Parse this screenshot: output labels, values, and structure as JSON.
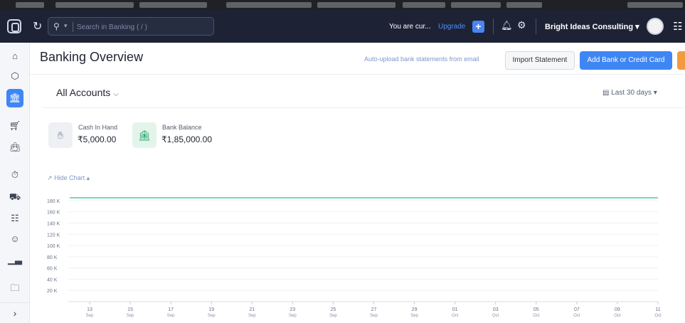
{
  "topbar": {
    "search_placeholder": "Search in Banking ( / )",
    "currency_text": "You are cur...",
    "upgrade_label": "Upgrade",
    "org_name": "Bright Ideas Consulting ▾"
  },
  "page": {
    "title": "Banking Overview",
    "auto_upload_link": "Auto-upload bank statements from email",
    "import_button": "Import Statement",
    "add_button": "Add Bank or Credit Card"
  },
  "accounts": {
    "selector": "All Accounts",
    "date_range": "Last 30 days ▾"
  },
  "stats": {
    "cash": {
      "label": "Cash In Hand",
      "value": "₹5,000.00"
    },
    "bank": {
      "label": "Bank Balance",
      "value": "₹1,85,000.00"
    }
  },
  "hide_chart_label": "Hide Chart ▴",
  "icons": {
    "sidebar": [
      "home-icon",
      "box-icon",
      "bank-icon",
      "cart-icon",
      "bag-icon",
      "clock-icon",
      "truck-icon",
      "document-icon",
      "users-icon",
      "reports-icon",
      "folder-icon"
    ]
  },
  "colors": {
    "topbar": "#1d2335",
    "accent": "#3f86f5",
    "series": "#52c7a8"
  },
  "chart_data": {
    "type": "line",
    "x": [
      "13 Sep",
      "15 Sep",
      "17 Sep",
      "19 Sep",
      "21 Sep",
      "23 Sep",
      "25 Sep",
      "27 Sep",
      "29 Sep",
      "01 Oct",
      "03 Oct",
      "05 Oct",
      "07 Oct",
      "09 Oct",
      "11 Oct"
    ],
    "x_ticks": [
      {
        "day": "13",
        "month": "Sep"
      },
      {
        "day": "15",
        "month": "Sep"
      },
      {
        "day": "17",
        "month": "Sep"
      },
      {
        "day": "19",
        "month": "Sep"
      },
      {
        "day": "21",
        "month": "Sep"
      },
      {
        "day": "23",
        "month": "Sep"
      },
      {
        "day": "25",
        "month": "Sep"
      },
      {
        "day": "27",
        "month": "Sep"
      },
      {
        "day": "29",
        "month": "Sep"
      },
      {
        "day": "01",
        "month": "Oct"
      },
      {
        "day": "03",
        "month": "Oct"
      },
      {
        "day": "05",
        "month": "Oct"
      },
      {
        "day": "07",
        "month": "Oct"
      },
      {
        "day": "09",
        "month": "Oct"
      },
      {
        "day": "11",
        "month": "Oct"
      }
    ],
    "series": [
      {
        "values": [
          185000,
          185000,
          185000,
          185000,
          185000,
          185000,
          185000,
          185000,
          185000,
          185000,
          185000,
          185000,
          185000,
          185000,
          185000
        ]
      }
    ],
    "y_ticks": [
      "180 K",
      "160 K",
      "140 K",
      "120 K",
      "100 K",
      "80 K",
      "60 K",
      "40 K",
      "20 K"
    ],
    "y_tick_values": [
      180000,
      160000,
      140000,
      120000,
      100000,
      80000,
      60000,
      40000,
      20000
    ],
    "ylim": [
      0,
      190000
    ],
    "grid": true
  }
}
